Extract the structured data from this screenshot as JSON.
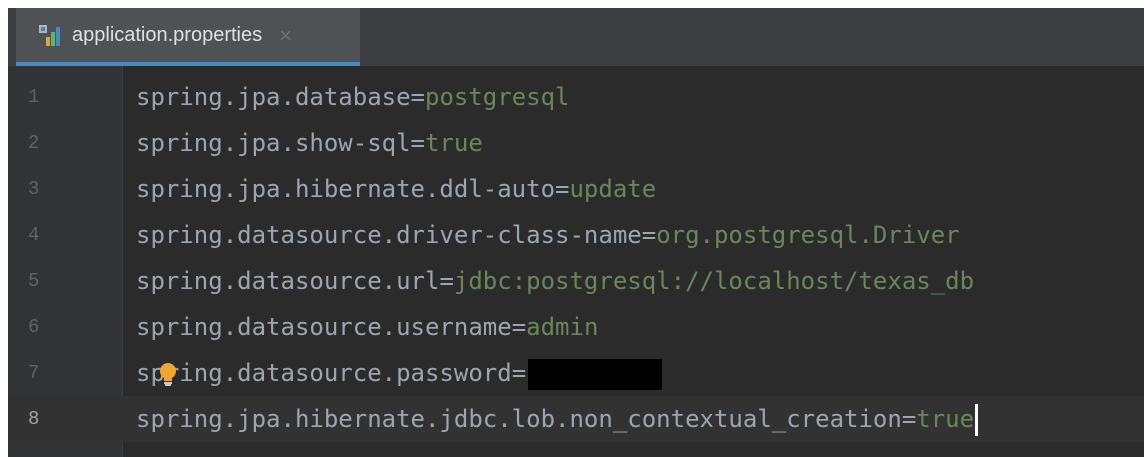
{
  "tab": {
    "label": "application.properties",
    "close_icon": "×",
    "icon": "properties-file-icon"
  },
  "colors": {
    "background": "#2b2b2b",
    "key": "#9da5b0",
    "value": "#6a8759",
    "tab_underline": "#4a88c7"
  },
  "current_line": 8,
  "lines": [
    {
      "num": "1",
      "key": "spring.jpa.database",
      "eq": "=",
      "value": "postgresql"
    },
    {
      "num": "2",
      "key": "spring.jpa.show-sql",
      "eq": "=",
      "value": "true"
    },
    {
      "num": "3",
      "key": "spring.jpa.hibernate.ddl-auto",
      "eq": "=",
      "value": "update"
    },
    {
      "num": "4",
      "key": "spring.datasource.driver-class-name",
      "eq": "=",
      "value": "org.postgresql.Driver"
    },
    {
      "num": "5",
      "key": "spring.datasource.url",
      "eq": "=",
      "value": "jdbc:postgresql://localhost/texas_db"
    },
    {
      "num": "6",
      "key": "spring.datasource.username",
      "eq": "=",
      "value": "admin"
    },
    {
      "num": "7",
      "key": "spring.datasource.password",
      "eq": "=",
      "value": "",
      "redacted": true,
      "intention_icon": "lightbulb-icon"
    },
    {
      "num": "8",
      "key": "spring.jpa.hibernate.jdbc.lob.non_contextual_creation",
      "eq": "=",
      "value": "true"
    }
  ]
}
